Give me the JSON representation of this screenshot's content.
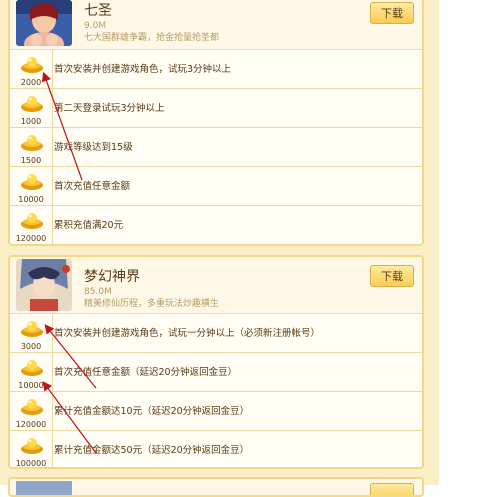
{
  "games": [
    {
      "title": "七圣",
      "size": "9.0M",
      "desc": "七大国群雄争霸，抢金抢量抢圣都",
      "download_label": "下载",
      "tasks": [
        {
          "amount": "2000",
          "text": "首次安装并创建游戏角色，试玩3分钟以上"
        },
        {
          "amount": "1000",
          "text": "第二天登录试玩3分钟以上"
        },
        {
          "amount": "1500",
          "text": "游戏等级达到15级"
        },
        {
          "amount": "10000",
          "text": "首次充值任意金额"
        },
        {
          "amount": "120000",
          "text": "累积充值满20元"
        }
      ]
    },
    {
      "title": "梦幻神界",
      "size": "85.0M",
      "desc": "精美修仙历程，多重玩法炒趣横生",
      "download_label": "下载",
      "tasks": [
        {
          "amount": "3000",
          "text": "首次安装并创建游戏角色，试玩一分钟以上（必须新注册帐号）"
        },
        {
          "amount": "10000",
          "text": "首次充值任意金额（延迟20分钟返回金豆）"
        },
        {
          "amount": "120000",
          "text": "累计充值金额达10元（延迟20分钟返回金豆）"
        },
        {
          "amount": "100000",
          "text": "累计充值金额达50元（延迟20分钟返回金豆）"
        }
      ]
    }
  ],
  "colors": {
    "accent_border": "#f3d889",
    "text": "#5b3a16",
    "arrow": "#c0141c",
    "coin": "#f2b416"
  }
}
